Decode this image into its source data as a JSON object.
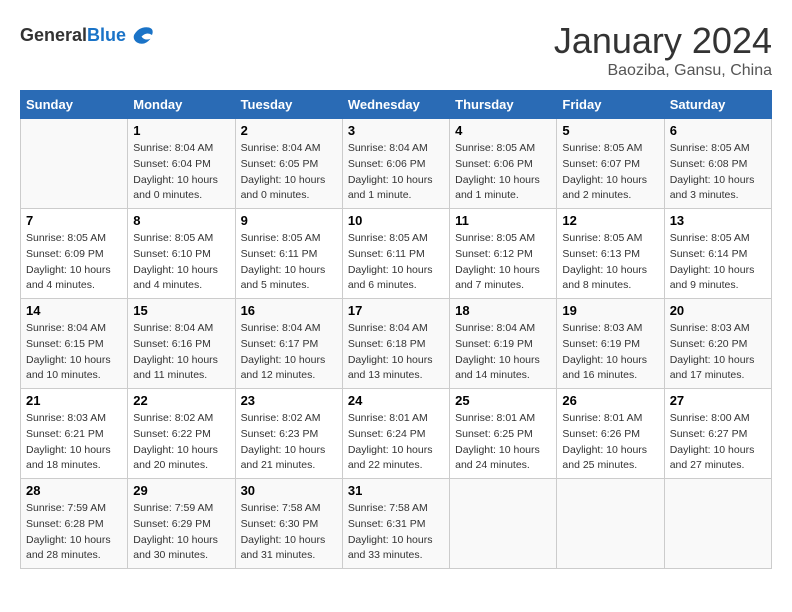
{
  "header": {
    "logo_general": "General",
    "logo_blue": "Blue",
    "month_title": "January 2024",
    "location": "Baoziba, Gansu, China"
  },
  "columns": [
    "Sunday",
    "Monday",
    "Tuesday",
    "Wednesday",
    "Thursday",
    "Friday",
    "Saturday"
  ],
  "weeks": [
    [
      {
        "day": "",
        "sunrise": "",
        "sunset": "",
        "daylight": ""
      },
      {
        "day": "1",
        "sunrise": "Sunrise: 8:04 AM",
        "sunset": "Sunset: 6:04 PM",
        "daylight": "Daylight: 10 hours and 0 minutes."
      },
      {
        "day": "2",
        "sunrise": "Sunrise: 8:04 AM",
        "sunset": "Sunset: 6:05 PM",
        "daylight": "Daylight: 10 hours and 0 minutes."
      },
      {
        "day": "3",
        "sunrise": "Sunrise: 8:04 AM",
        "sunset": "Sunset: 6:06 PM",
        "daylight": "Daylight: 10 hours and 1 minute."
      },
      {
        "day": "4",
        "sunrise": "Sunrise: 8:05 AM",
        "sunset": "Sunset: 6:06 PM",
        "daylight": "Daylight: 10 hours and 1 minute."
      },
      {
        "day": "5",
        "sunrise": "Sunrise: 8:05 AM",
        "sunset": "Sunset: 6:07 PM",
        "daylight": "Daylight: 10 hours and 2 minutes."
      },
      {
        "day": "6",
        "sunrise": "Sunrise: 8:05 AM",
        "sunset": "Sunset: 6:08 PM",
        "daylight": "Daylight: 10 hours and 3 minutes."
      }
    ],
    [
      {
        "day": "7",
        "sunrise": "Sunrise: 8:05 AM",
        "sunset": "Sunset: 6:09 PM",
        "daylight": "Daylight: 10 hours and 4 minutes."
      },
      {
        "day": "8",
        "sunrise": "Sunrise: 8:05 AM",
        "sunset": "Sunset: 6:10 PM",
        "daylight": "Daylight: 10 hours and 4 minutes."
      },
      {
        "day": "9",
        "sunrise": "Sunrise: 8:05 AM",
        "sunset": "Sunset: 6:11 PM",
        "daylight": "Daylight: 10 hours and 5 minutes."
      },
      {
        "day": "10",
        "sunrise": "Sunrise: 8:05 AM",
        "sunset": "Sunset: 6:11 PM",
        "daylight": "Daylight: 10 hours and 6 minutes."
      },
      {
        "day": "11",
        "sunrise": "Sunrise: 8:05 AM",
        "sunset": "Sunset: 6:12 PM",
        "daylight": "Daylight: 10 hours and 7 minutes."
      },
      {
        "day": "12",
        "sunrise": "Sunrise: 8:05 AM",
        "sunset": "Sunset: 6:13 PM",
        "daylight": "Daylight: 10 hours and 8 minutes."
      },
      {
        "day": "13",
        "sunrise": "Sunrise: 8:05 AM",
        "sunset": "Sunset: 6:14 PM",
        "daylight": "Daylight: 10 hours and 9 minutes."
      }
    ],
    [
      {
        "day": "14",
        "sunrise": "Sunrise: 8:04 AM",
        "sunset": "Sunset: 6:15 PM",
        "daylight": "Daylight: 10 hours and 10 minutes."
      },
      {
        "day": "15",
        "sunrise": "Sunrise: 8:04 AM",
        "sunset": "Sunset: 6:16 PM",
        "daylight": "Daylight: 10 hours and 11 minutes."
      },
      {
        "day": "16",
        "sunrise": "Sunrise: 8:04 AM",
        "sunset": "Sunset: 6:17 PM",
        "daylight": "Daylight: 10 hours and 12 minutes."
      },
      {
        "day": "17",
        "sunrise": "Sunrise: 8:04 AM",
        "sunset": "Sunset: 6:18 PM",
        "daylight": "Daylight: 10 hours and 13 minutes."
      },
      {
        "day": "18",
        "sunrise": "Sunrise: 8:04 AM",
        "sunset": "Sunset: 6:19 PM",
        "daylight": "Daylight: 10 hours and 14 minutes."
      },
      {
        "day": "19",
        "sunrise": "Sunrise: 8:03 AM",
        "sunset": "Sunset: 6:19 PM",
        "daylight": "Daylight: 10 hours and 16 minutes."
      },
      {
        "day": "20",
        "sunrise": "Sunrise: 8:03 AM",
        "sunset": "Sunset: 6:20 PM",
        "daylight": "Daylight: 10 hours and 17 minutes."
      }
    ],
    [
      {
        "day": "21",
        "sunrise": "Sunrise: 8:03 AM",
        "sunset": "Sunset: 6:21 PM",
        "daylight": "Daylight: 10 hours and 18 minutes."
      },
      {
        "day": "22",
        "sunrise": "Sunrise: 8:02 AM",
        "sunset": "Sunset: 6:22 PM",
        "daylight": "Daylight: 10 hours and 20 minutes."
      },
      {
        "day": "23",
        "sunrise": "Sunrise: 8:02 AM",
        "sunset": "Sunset: 6:23 PM",
        "daylight": "Daylight: 10 hours and 21 minutes."
      },
      {
        "day": "24",
        "sunrise": "Sunrise: 8:01 AM",
        "sunset": "Sunset: 6:24 PM",
        "daylight": "Daylight: 10 hours and 22 minutes."
      },
      {
        "day": "25",
        "sunrise": "Sunrise: 8:01 AM",
        "sunset": "Sunset: 6:25 PM",
        "daylight": "Daylight: 10 hours and 24 minutes."
      },
      {
        "day": "26",
        "sunrise": "Sunrise: 8:01 AM",
        "sunset": "Sunset: 6:26 PM",
        "daylight": "Daylight: 10 hours and 25 minutes."
      },
      {
        "day": "27",
        "sunrise": "Sunrise: 8:00 AM",
        "sunset": "Sunset: 6:27 PM",
        "daylight": "Daylight: 10 hours and 27 minutes."
      }
    ],
    [
      {
        "day": "28",
        "sunrise": "Sunrise: 7:59 AM",
        "sunset": "Sunset: 6:28 PM",
        "daylight": "Daylight: 10 hours and 28 minutes."
      },
      {
        "day": "29",
        "sunrise": "Sunrise: 7:59 AM",
        "sunset": "Sunset: 6:29 PM",
        "daylight": "Daylight: 10 hours and 30 minutes."
      },
      {
        "day": "30",
        "sunrise": "Sunrise: 7:58 AM",
        "sunset": "Sunset: 6:30 PM",
        "daylight": "Daylight: 10 hours and 31 minutes."
      },
      {
        "day": "31",
        "sunrise": "Sunrise: 7:58 AM",
        "sunset": "Sunset: 6:31 PM",
        "daylight": "Daylight: 10 hours and 33 minutes."
      },
      {
        "day": "",
        "sunrise": "",
        "sunset": "",
        "daylight": ""
      },
      {
        "day": "",
        "sunrise": "",
        "sunset": "",
        "daylight": ""
      },
      {
        "day": "",
        "sunrise": "",
        "sunset": "",
        "daylight": ""
      }
    ]
  ]
}
